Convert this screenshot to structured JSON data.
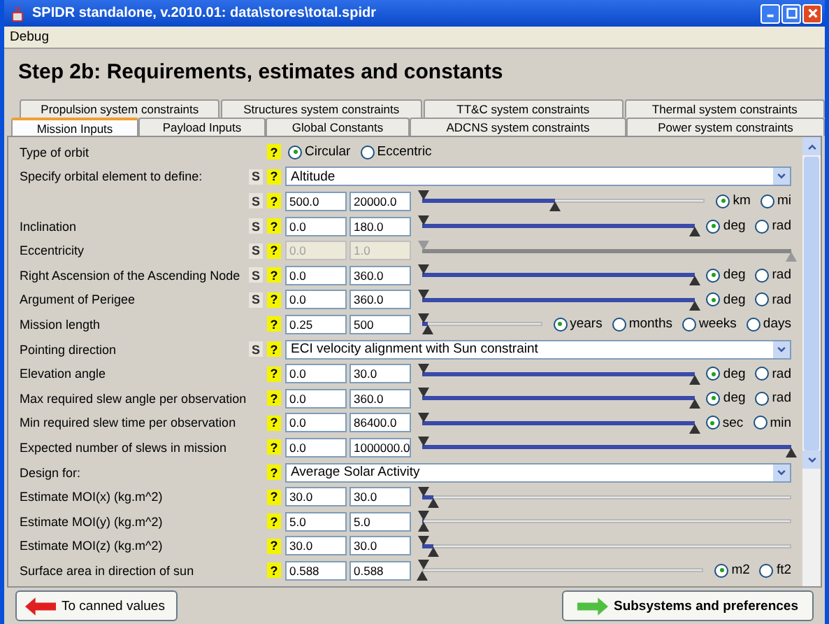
{
  "window": {
    "title": "SPIDR standalone, v.2010.01: data\\stores\\total.spidr"
  },
  "menu": [
    "Debug"
  ],
  "heading": "Step 2b: Requirements, estimates and constants",
  "tab_rows": [
    [
      {
        "label": "Propulsion system constraints",
        "selected": false
      },
      {
        "label": "Structures system constraints",
        "selected": false
      },
      {
        "label": "TT&C system constraints",
        "selected": false
      },
      {
        "label": "Thermal system constraints",
        "selected": false
      }
    ],
    [
      {
        "label": "Mission Inputs",
        "selected": true
      },
      {
        "label": "Payload Inputs",
        "selected": false
      },
      {
        "label": "Global Constants",
        "selected": false
      },
      {
        "label": "ADCNS system constraints",
        "selected": false
      },
      {
        "label": "Power system constraints",
        "selected": false
      }
    ]
  ],
  "rows": [
    {
      "kind": "radio",
      "label": "Type of orbit",
      "help": "?",
      "options": [
        {
          "label": "Circular",
          "selected": true
        },
        {
          "label": "Eccentric",
          "selected": false
        }
      ]
    },
    {
      "kind": "combo",
      "label": "Specify orbital element to define:",
      "s": "S",
      "help": "?",
      "value": "Altitude"
    },
    {
      "kind": "range",
      "s": "S",
      "help": "?",
      "min": "500.0",
      "max": "20000.0",
      "level": 0.47,
      "disabled": false,
      "units": [
        {
          "label": "km",
          "selected": true
        },
        {
          "label": "mi",
          "selected": false
        }
      ]
    },
    {
      "kind": "range",
      "label": "Inclination",
      "s": "S",
      "help": "?",
      "min": "0.0",
      "max": "180.0",
      "level": 1,
      "disabled": false,
      "units": [
        {
          "label": "deg",
          "selected": true
        },
        {
          "label": "rad",
          "selected": false
        }
      ]
    },
    {
      "kind": "range",
      "label": "Eccentricity",
      "s": "S",
      "help": "?",
      "min": "0.0",
      "max": "1.0",
      "level": 1,
      "disabled": true
    },
    {
      "kind": "range",
      "label": "Right Ascension of the Ascending Node",
      "s": "S",
      "help": "?",
      "min": "0.0",
      "max": "360.0",
      "level": 1,
      "disabled": false,
      "units": [
        {
          "label": "deg",
          "selected": true
        },
        {
          "label": "rad",
          "selected": false
        }
      ]
    },
    {
      "kind": "range",
      "label": "Argument of Perigee",
      "s": "S",
      "help": "?",
      "min": "0.0",
      "max": "360.0",
      "level": 1,
      "disabled": false,
      "units": [
        {
          "label": "deg",
          "selected": true
        },
        {
          "label": "rad",
          "selected": false
        }
      ]
    },
    {
      "kind": "range",
      "label": "Mission length",
      "help": "?",
      "min": "0.25",
      "max": "500",
      "level": 0.05,
      "disabled": false,
      "units": [
        {
          "label": "years",
          "selected": true
        },
        {
          "label": "months",
          "selected": false
        },
        {
          "label": "weeks",
          "selected": false
        },
        {
          "label": "days",
          "selected": false
        }
      ]
    },
    {
      "kind": "combo",
      "label": "Pointing direction",
      "s": "S",
      "help": "?",
      "value": "ECI velocity alignment with Sun constraint"
    },
    {
      "kind": "range",
      "label": "Elevation angle",
      "help": "?",
      "min": "0.0",
      "max": "30.0",
      "level": 1,
      "disabled": false,
      "units": [
        {
          "label": "deg",
          "selected": true
        },
        {
          "label": "rad",
          "selected": false
        }
      ]
    },
    {
      "kind": "range",
      "label": "Max required slew angle per observation",
      "help": "?",
      "min": "0.0",
      "max": "360.0",
      "level": 1,
      "disabled": false,
      "units": [
        {
          "label": "deg",
          "selected": true
        },
        {
          "label": "rad",
          "selected": false
        }
      ]
    },
    {
      "kind": "range",
      "label": "Min required slew time per observation",
      "help": "?",
      "min": "0.0",
      "max": "86400.0",
      "level": 1,
      "disabled": false,
      "units": [
        {
          "label": "sec",
          "selected": true
        },
        {
          "label": "min",
          "selected": false
        }
      ]
    },
    {
      "kind": "range",
      "label": "Expected number of slews in mission",
      "help": "?",
      "min": "0.0",
      "max": "1000000.0",
      "level": 1,
      "disabled": false
    },
    {
      "kind": "combo",
      "label": "Design for:",
      "help": "?",
      "value": "Average Solar Activity"
    },
    {
      "kind": "range",
      "label": "Estimate MOI(x) (kg.m^2)",
      "help": "?",
      "min": "30.0",
      "max": "30.0",
      "level": 0.03,
      "disabled": false
    },
    {
      "kind": "range",
      "label": "Estimate MOI(y) (kg.m^2)",
      "help": "?",
      "min": "5.0",
      "max": "5.0",
      "level": 0.005,
      "disabled": false
    },
    {
      "kind": "range",
      "label": "Estimate MOI(z) (kg.m^2)",
      "help": "?",
      "min": "30.0",
      "max": "30.0",
      "level": 0.03,
      "disabled": false
    },
    {
      "kind": "range",
      "label": "Surface area in direction of sun",
      "help": "?",
      "min": "0.588",
      "max": "0.588",
      "level": 0.0,
      "disabled": false,
      "units": [
        {
          "label": "m2",
          "selected": true
        },
        {
          "label": "ft2",
          "selected": false
        }
      ]
    }
  ],
  "buttons": {
    "back": "To canned values",
    "next": "Subsystems and preferences"
  }
}
